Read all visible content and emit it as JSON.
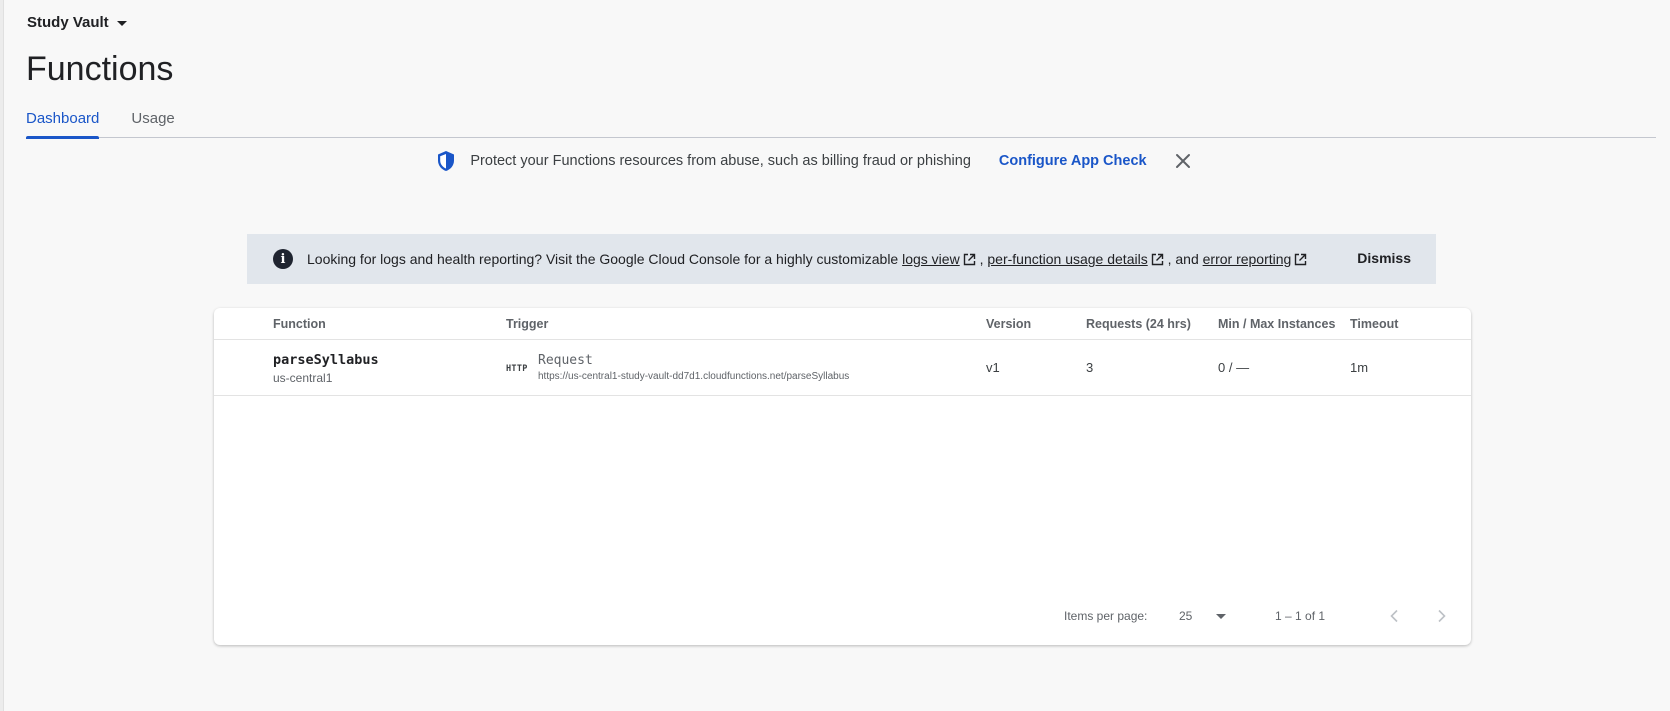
{
  "project": {
    "name": "Study Vault"
  },
  "page": {
    "title": "Functions"
  },
  "tabs": [
    {
      "label": "Dashboard",
      "active": true
    },
    {
      "label": "Usage",
      "active": false
    }
  ],
  "app_check_banner": {
    "message": "Protect your Functions resources from abuse, such as billing fraud or phishing",
    "link_label": "Configure App Check"
  },
  "info_banner": {
    "prefix": "Looking for logs and health reporting? Visit the Google Cloud Console for a highly customizable ",
    "link1": "logs view",
    "sep1": " , ",
    "link2": "per-function usage details",
    "sep2": " , and ",
    "link3": "error reporting",
    "dismiss_label": "Dismiss"
  },
  "table": {
    "columns": [
      "Function",
      "Trigger",
      "Version",
      "Requests (24 hrs)",
      "Min / Max Instances",
      "Timeout"
    ],
    "rows": [
      {
        "function": "parseSyllabus",
        "region": "us-central1",
        "trigger_badge": "HTTP",
        "trigger_type": "Request",
        "trigger_url": "https://us-central1-study-vault-dd7d1.cloudfunctions.net/parseSyllabus",
        "version": "v1",
        "requests": "3",
        "instances": "0 / —",
        "timeout": "1m"
      }
    ]
  },
  "paginator": {
    "items_per_page_label": "Items per page:",
    "page_size": "25",
    "range": "1 – 1 of 1"
  },
  "colors": {
    "accent": "#1a56c8",
    "info_banner_bg": "#e1e6ec",
    "page_bg": "#f8f8f8"
  }
}
